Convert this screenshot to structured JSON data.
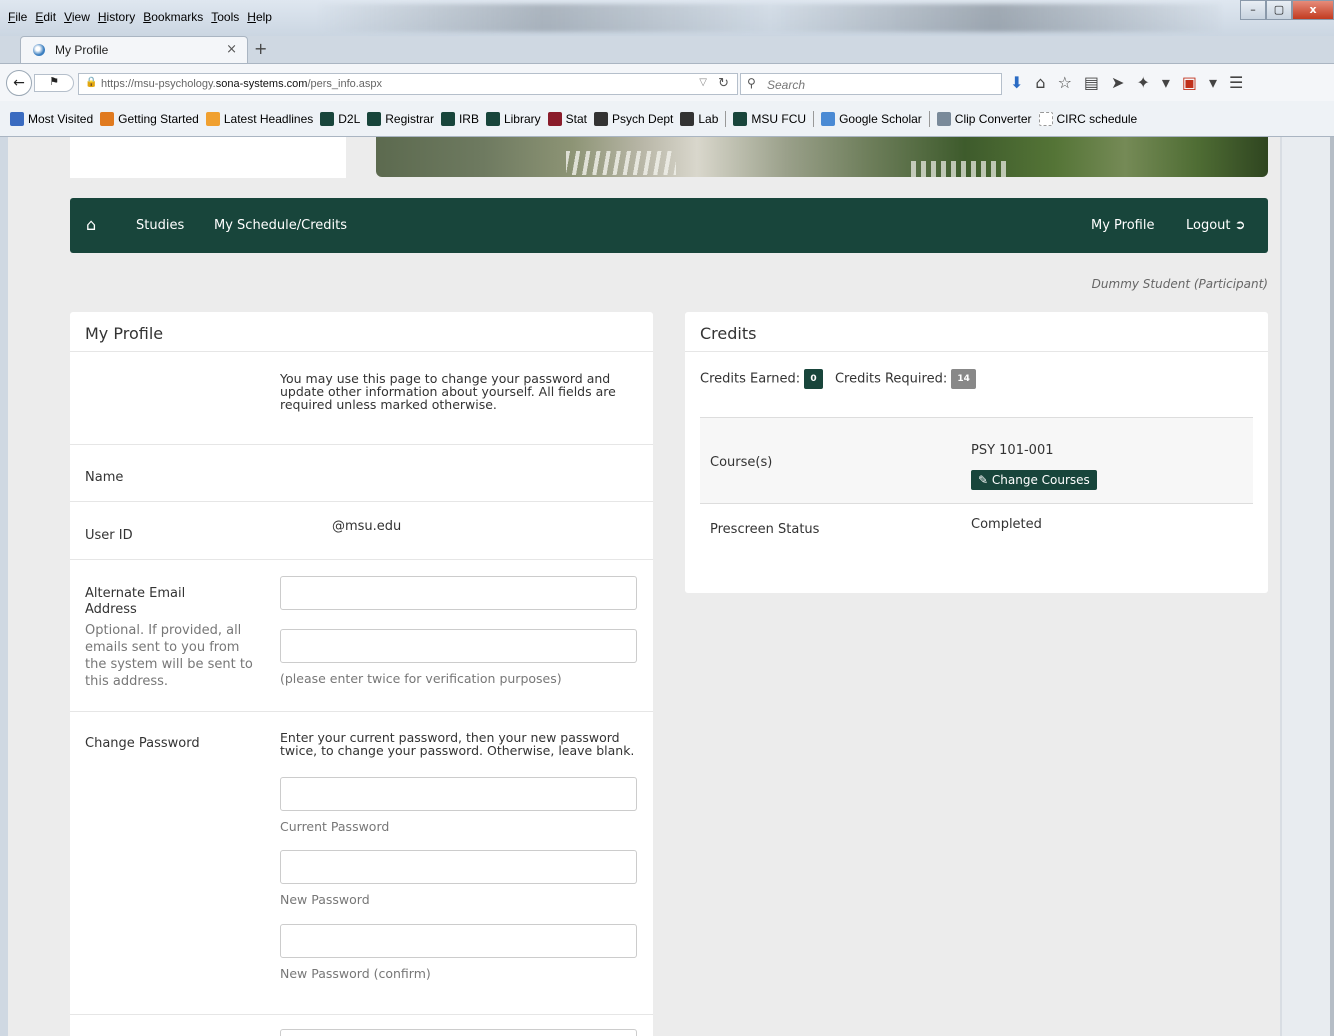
{
  "browser": {
    "menu": [
      "File",
      "Edit",
      "View",
      "History",
      "Bookmarks",
      "Tools",
      "Help"
    ],
    "window_controls": [
      "–",
      "▢",
      "x"
    ],
    "tab": {
      "title": "My Profile",
      "close": "×",
      "new_tab": "+"
    },
    "url": {
      "prefix": "https://msu-psychology.",
      "domain": "sona-systems.com",
      "path": "/pers_info.aspx"
    },
    "search_placeholder": "Search",
    "bookmarks": [
      {
        "label": "Most Visited",
        "icon": "bookmark-folder-icon",
        "color": "#3a6bc0"
      },
      {
        "label": "Getting Started",
        "icon": "firefox-icon",
        "color": "#e07a1f"
      },
      {
        "label": "Latest Headlines",
        "icon": "rss-icon",
        "color": "#f0a030"
      },
      {
        "label": "D2L",
        "icon": "spartan-s-icon",
        "color": "#18453b"
      },
      {
        "label": "Registrar",
        "icon": "spartan-helmet-icon",
        "color": "#18453b"
      },
      {
        "label": "IRB",
        "icon": "spartan-s-icon",
        "color": "#18453b"
      },
      {
        "label": "Library",
        "icon": "spartan-s-icon",
        "color": "#18453b"
      },
      {
        "label": "Stat",
        "icon": "v-logo-icon",
        "color": "#8a1c2b"
      },
      {
        "label": "Psych Dept",
        "icon": "p-logo-icon",
        "color": "#333333"
      },
      {
        "label": "Lab",
        "icon": "p-logo-icon",
        "color": "#333333"
      },
      {
        "label": "MSU FCU",
        "icon": "msu-fcu-icon",
        "color": "#18453b"
      },
      {
        "label": "Google Scholar",
        "icon": "scholar-icon",
        "color": "#4a8ad4"
      },
      {
        "label": "Clip Converter",
        "icon": "clip-converter-icon",
        "color": "#7a8a9a"
      },
      {
        "label": "CIRC schedule",
        "icon": "blank-page-icon",
        "color": "#ffffff"
      }
    ]
  },
  "site": {
    "nav": {
      "home_icon": "home-icon",
      "studies": "Studies",
      "schedule": "My Schedule/Credits",
      "profile": "My Profile",
      "logout": "Logout"
    },
    "user": "Dummy Student (Participant)",
    "brand_color": "#18453b"
  },
  "profile": {
    "title": "My Profile",
    "intro": "You may use this page to change your password and update other information about yourself. All fields are required unless marked otherwise.",
    "name_label": "Name",
    "userid_label": "User ID",
    "userid_value": "@msu.edu",
    "alt_email_label": "Alternate Email Address",
    "alt_email_help": "Optional. If provided, all emails sent to you from the system will be sent to this address.",
    "alt_email_note": "(please enter twice for verification purposes)",
    "password_label": "Change Password",
    "password_help": "Enter your current password, then your new password twice, to change your password. Otherwise, leave blank.",
    "current_password": "Current Password",
    "new_password": "New Password",
    "new_password_confirm": "New Password (confirm)"
  },
  "credits": {
    "title": "Credits",
    "earned_label": "Credits Earned:",
    "earned": "0",
    "required_label": "Credits Required:",
    "required": "14",
    "course_label": "Course(s)",
    "course_value": "PSY 101-001",
    "change_courses": "Change Courses",
    "prescreen_label": "Prescreen Status",
    "prescreen_value": "Completed"
  }
}
